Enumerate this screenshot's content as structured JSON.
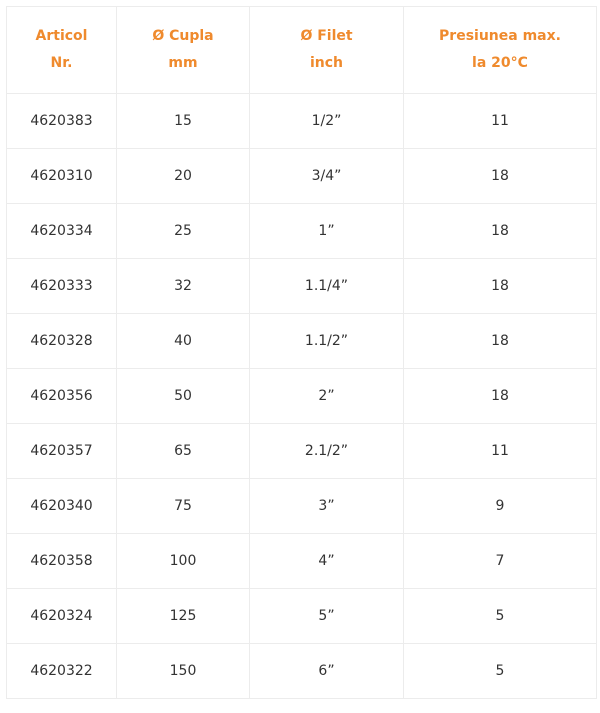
{
  "table": {
    "columns": [
      [
        "Articol",
        "Nr."
      ],
      [
        "Ø Cupla",
        "mm"
      ],
      [
        "Ø Filet",
        "inch"
      ],
      [
        "Presiunea max.",
        "la 20°C"
      ]
    ],
    "rows": [
      [
        "4620383",
        "15",
        "1/2”",
        "11"
      ],
      [
        "4620310",
        "20",
        "3/4”",
        "18"
      ],
      [
        "4620334",
        "25",
        "1”",
        "18"
      ],
      [
        "4620333",
        "32",
        "1.1/4”",
        "18"
      ],
      [
        "4620328",
        "40",
        "1.1/2”",
        "18"
      ],
      [
        "4620356",
        "50",
        "2”",
        "18"
      ],
      [
        "4620357",
        "65",
        "2.1/2”",
        "11"
      ],
      [
        "4620340",
        "75",
        "3”",
        "9"
      ],
      [
        "4620358",
        "100",
        "4”",
        "7"
      ],
      [
        "4620324",
        "125",
        "5”",
        "5"
      ],
      [
        "4620322",
        "150",
        "6”",
        "5"
      ]
    ]
  },
  "colors": {
    "header_text": "#ef8a2d",
    "cell_text": "#333333",
    "border": "#ececec"
  }
}
